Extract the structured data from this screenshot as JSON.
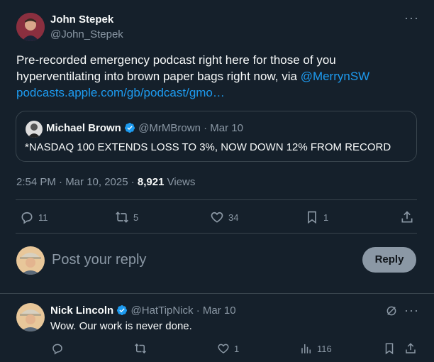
{
  "tweet": {
    "author_name": "John Stepek",
    "author_handle": "@John_Stepek",
    "text_main": "Pre-recorded emergency podcast right here for those of you hyperventilating into brown paper bags right now, via ",
    "mention": "@MerrynSW",
    "link": "podcasts.apple.com/gb/podcast/gmo…",
    "timestamp": "2:54 PM · Mar 10, 2025 · ",
    "views_count": "8,921",
    "views_label": " Views"
  },
  "quote": {
    "author_name": "Michael Brown",
    "author_handle": "@MrMBrown",
    "date": "· Mar 10",
    "text": "*NASDAQ 100 EXTENDS LOSS TO 3%, NOW DOWN 12% FROM RECORD"
  },
  "actions": {
    "replies": "11",
    "reposts": "5",
    "likes": "34",
    "bookmarks": "1"
  },
  "reply_box": {
    "placeholder": "Post your reply",
    "button_label": "Reply"
  },
  "reply": {
    "author_name": "Nick Lincoln",
    "author_handle": "@HatTipNick",
    "date": "· Mar 10",
    "text": "Wow. Our work is never done.",
    "likes": "1",
    "views": "116"
  },
  "colors": {
    "background": "#15202b",
    "accent": "#1d9bf0",
    "muted": "#8b98a5",
    "divider": "#38444d"
  }
}
